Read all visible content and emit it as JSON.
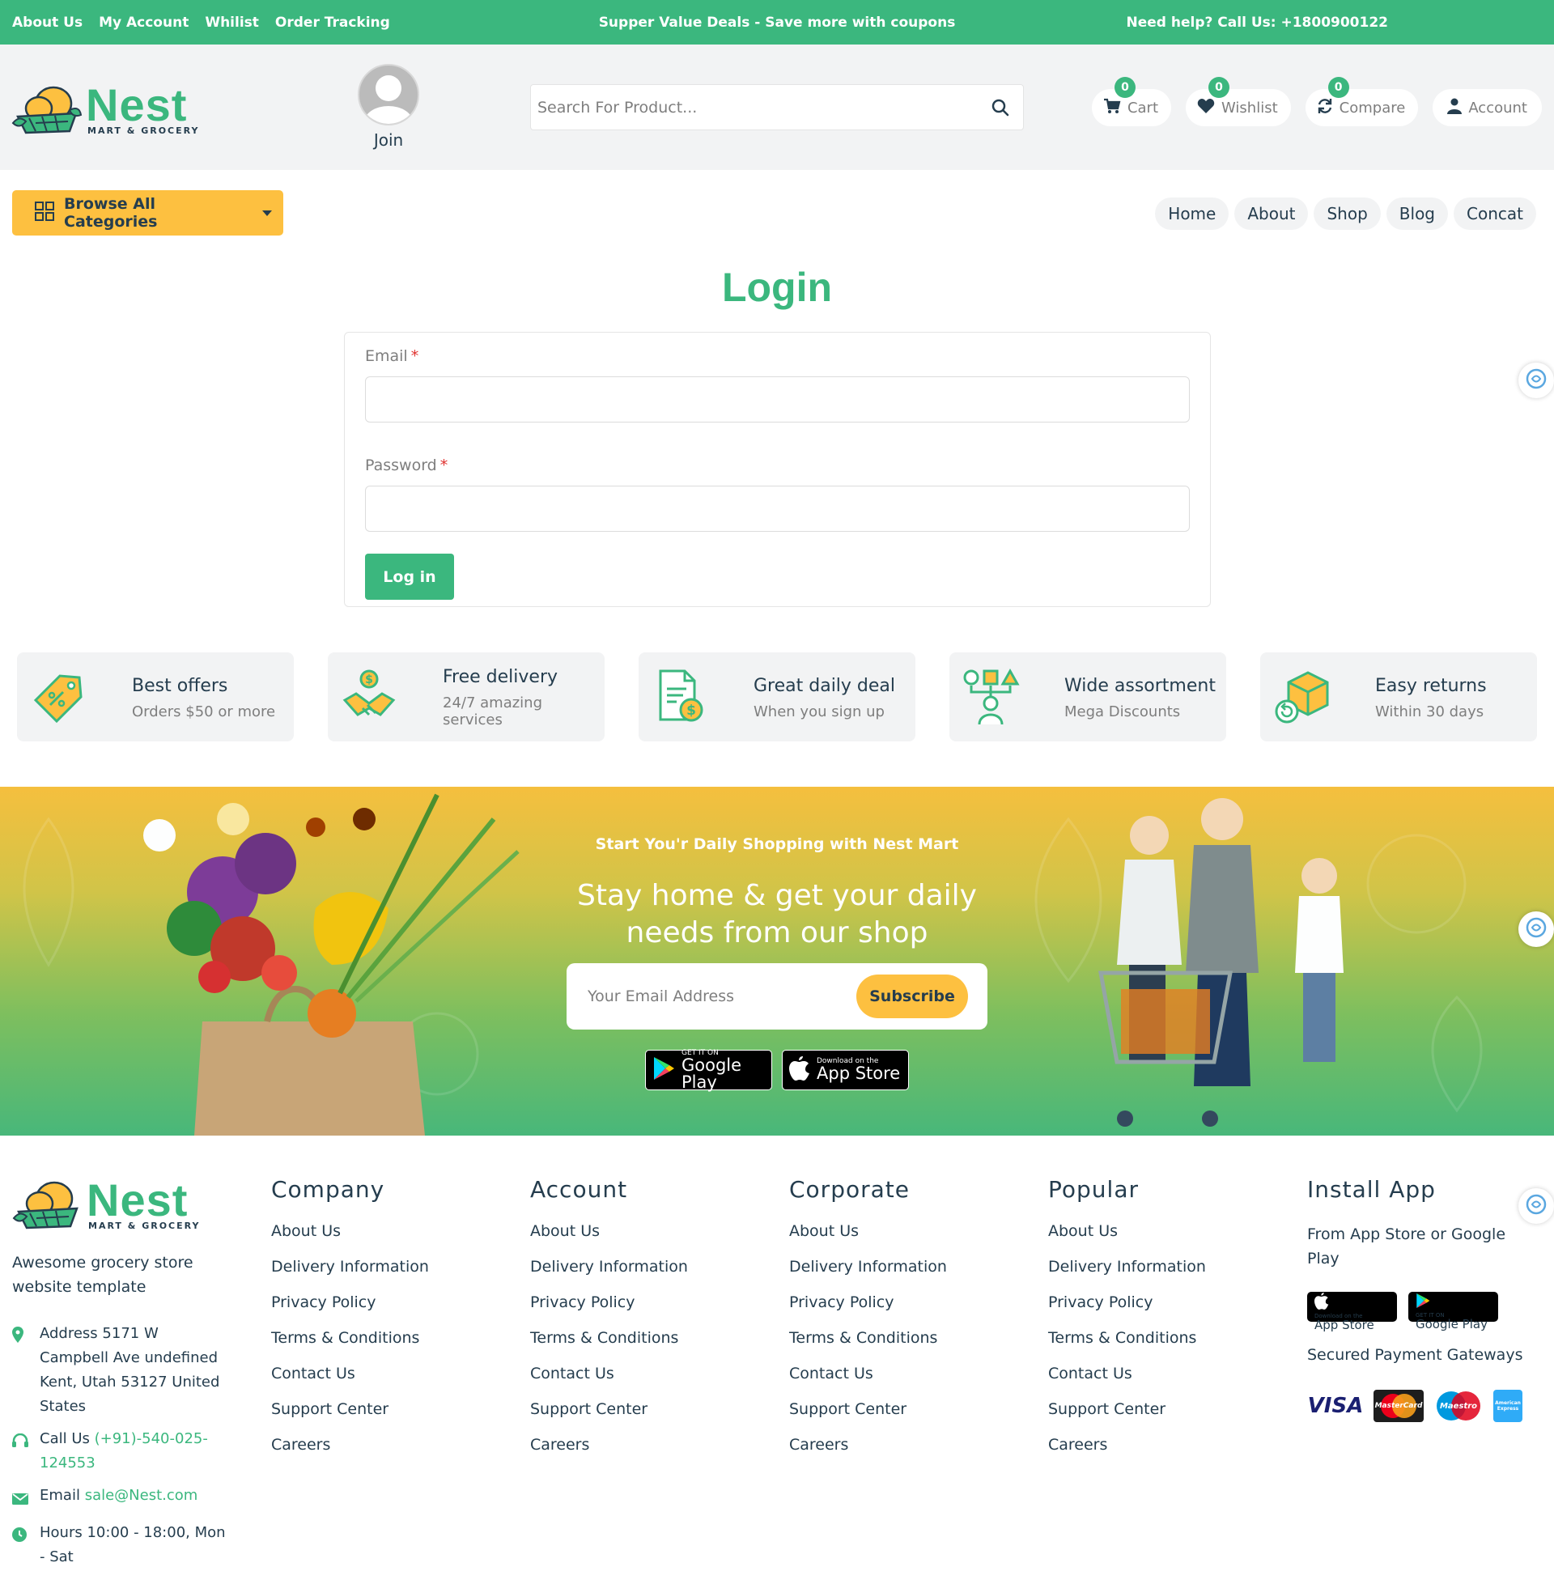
{
  "topbar": {
    "links": [
      "About Us",
      "My Account",
      "Whilist",
      "Order Tracking"
    ],
    "promo": "Supper Value Deals - Save more with coupons",
    "help": "Need help? Call Us: +1800900122"
  },
  "logo": {
    "name": "Nest",
    "sub": "MART & GROCERY"
  },
  "join_label": "Join",
  "search": {
    "placeholder": "Search For Product..."
  },
  "header_actions": {
    "cart": {
      "label": "Cart",
      "count": "0"
    },
    "wishlist": {
      "label": "Wishlist",
      "count": "0"
    },
    "compare": {
      "label": "Compare",
      "count": "0"
    },
    "account": {
      "label": "Account"
    }
  },
  "browse_label": "Browse All Categories",
  "nav": [
    "Home",
    "About",
    "Shop",
    "Blog",
    "Concat"
  ],
  "login": {
    "title": "Login",
    "email_label": "Email",
    "password_label": "Password",
    "required_mark": "*",
    "submit": "Log in"
  },
  "features": [
    {
      "title": "Best offers",
      "sub": "Orders $50 or more",
      "icon": "discount-tag-icon"
    },
    {
      "title": "Free delivery",
      "sub": "24/7 amazing services",
      "icon": "handshake-coin-icon"
    },
    {
      "title": "Great daily deal",
      "sub": "When you sign up",
      "icon": "invoice-dollar-icon"
    },
    {
      "title": "Wide assortment",
      "sub": "Mega Discounts",
      "icon": "assortment-icon"
    },
    {
      "title": "Easy returns",
      "sub": "Within 30 days",
      "icon": "return-box-icon"
    }
  ],
  "banner": {
    "pretitle": "Start You'r Daily Shopping with Nest Mart",
    "title_line1": "Stay home & get your daily",
    "title_line2": "needs from our shop",
    "email_placeholder": "Your Email Address",
    "subscribe": "Subscribe",
    "google_small": "GET IT ON",
    "google_big": "Google Play",
    "apple_small": "Download on the",
    "apple_big": "App Store"
  },
  "footer": {
    "description": "Awesome grocery store website template",
    "address_label": "Address",
    "address": "5171 W Campbell Ave undefined Kent, Utah 53127 United States",
    "call_label": "Call Us",
    "phone": "(+91)-540-025-124553",
    "email_label": "Email",
    "email": "sale@Nest.com",
    "hours_label": "Hours",
    "hours": "10:00 - 18:00, Mon - Sat",
    "columns": [
      {
        "title": "Company",
        "links": [
          "About Us",
          "Delivery Information",
          "Privacy Policy",
          "Terms & Conditions",
          "Contact Us",
          "Support Center",
          "Careers"
        ]
      },
      {
        "title": "Account",
        "links": [
          "About Us",
          "Delivery Information",
          "Privacy Policy",
          "Terms & Conditions",
          "Contact Us",
          "Support Center",
          "Careers"
        ]
      },
      {
        "title": "Corporate",
        "links": [
          "About Us",
          "Delivery Information",
          "Privacy Policy",
          "Terms & Conditions",
          "Contact Us",
          "Support Center",
          "Careers"
        ]
      },
      {
        "title": "Popular",
        "links": [
          "About Us",
          "Delivery Information",
          "Privacy Policy",
          "Terms & Conditions",
          "Contact Us",
          "Support Center",
          "Careers"
        ]
      }
    ],
    "install": {
      "title": "Install App",
      "desc": "From App Store or Google Play",
      "payments_title": "Secured Payment Gateways",
      "payments": [
        "VISA",
        "MasterCard",
        "Maestro",
        "American Express"
      ]
    }
  },
  "colors": {
    "brand": "#3bb77e",
    "accent": "#fdc040",
    "text": "#253d4e",
    "muted": "#7e7e7e"
  }
}
